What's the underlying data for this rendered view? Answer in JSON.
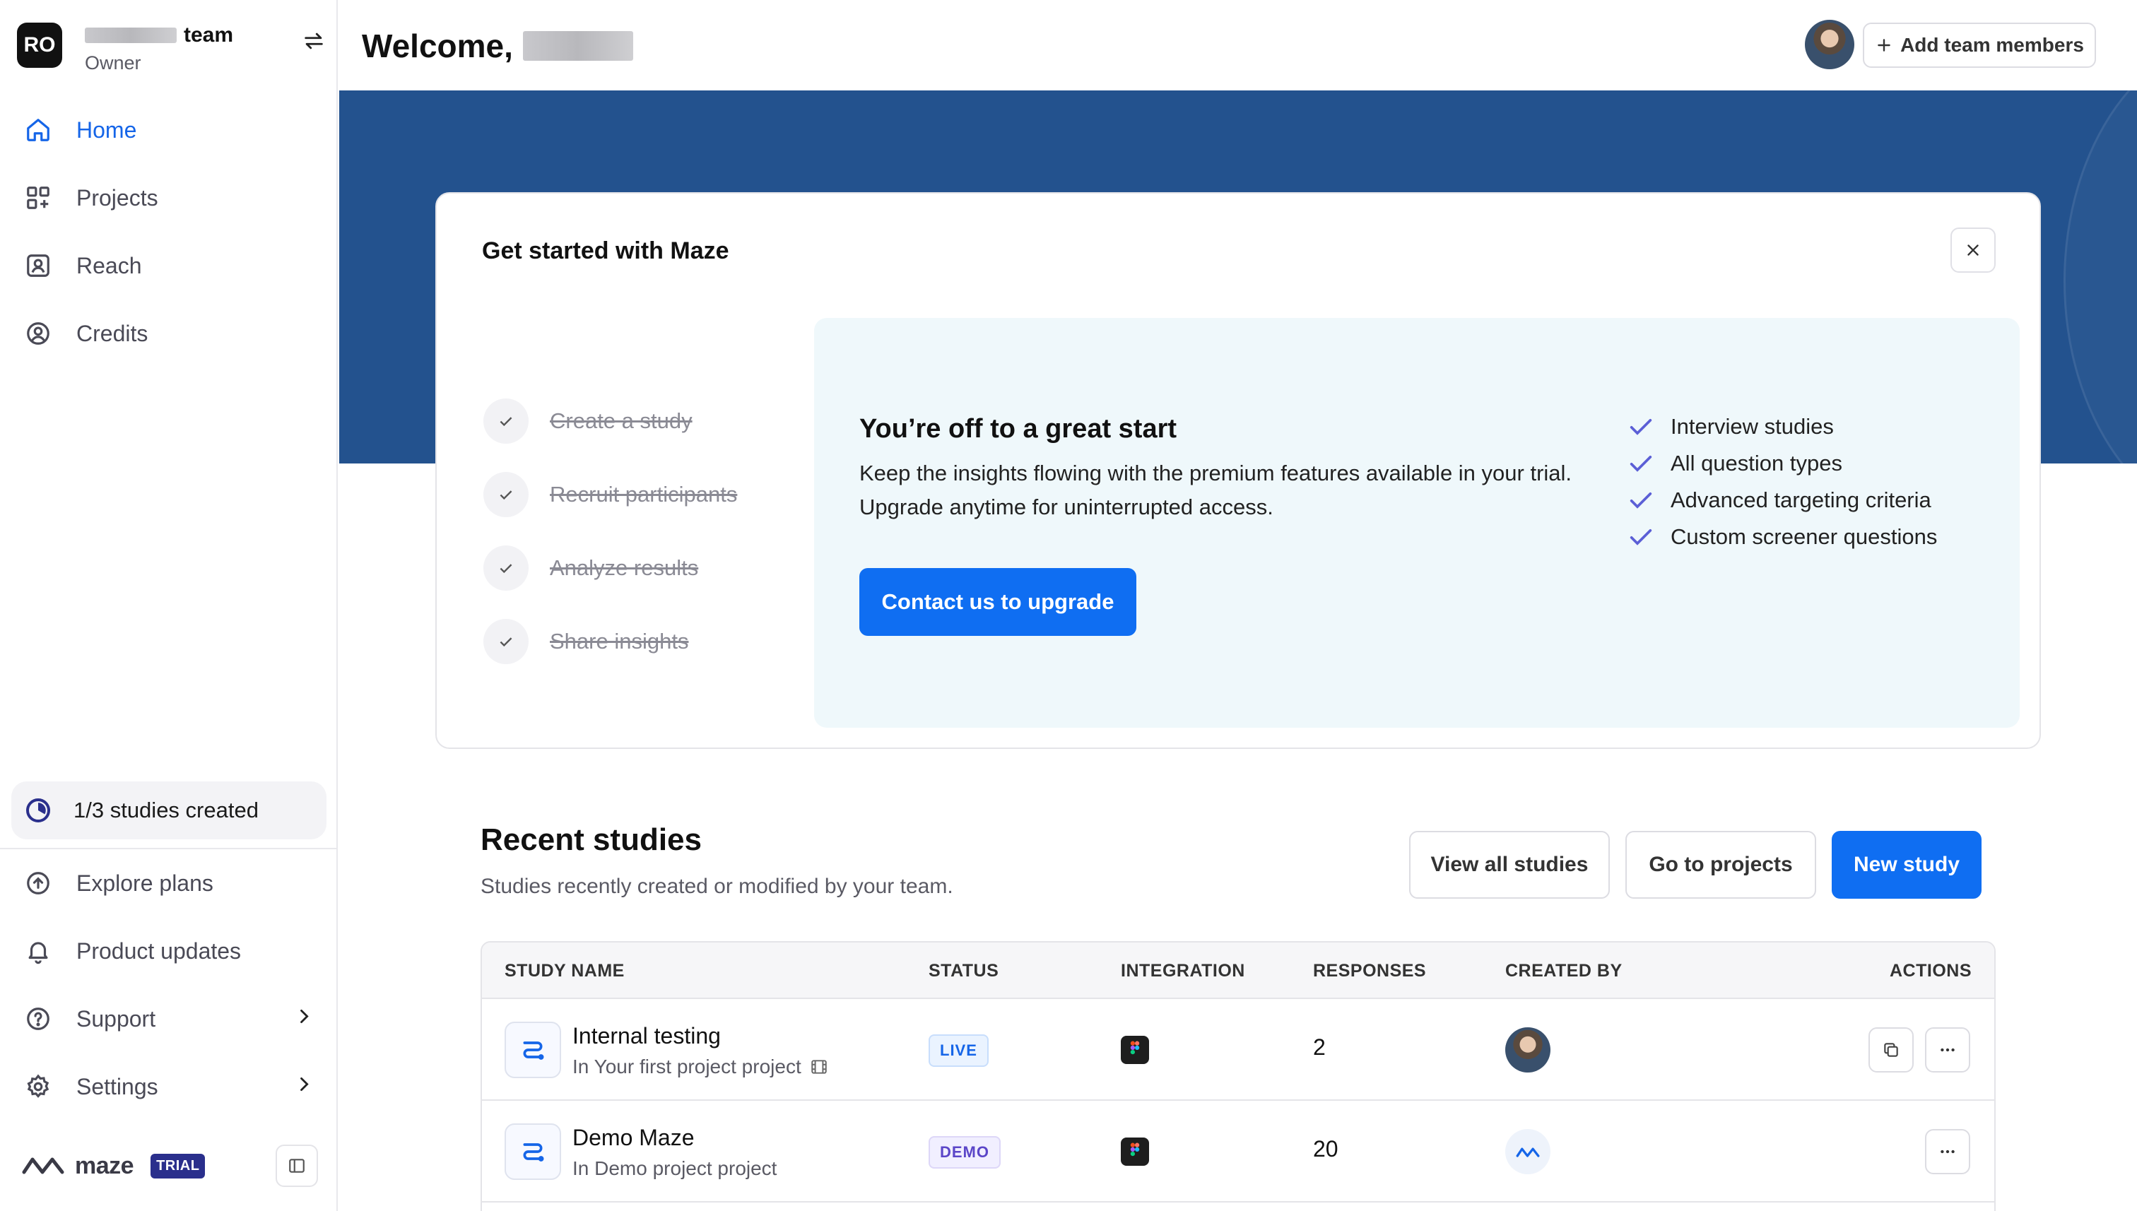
{
  "sidebar": {
    "team": {
      "initials": "RO",
      "name_suffix": "team",
      "role": "Owner"
    },
    "nav": [
      {
        "label": "Home",
        "icon": "home-icon",
        "active": true
      },
      {
        "label": "Projects",
        "icon": "projects-icon"
      },
      {
        "label": "Reach",
        "icon": "reach-icon"
      },
      {
        "label": "Credits",
        "icon": "credits-icon"
      }
    ],
    "studies_progress": "1/3 studies created",
    "bottom_nav": [
      {
        "label": "Explore plans",
        "icon": "arrow-up-circle-icon"
      },
      {
        "label": "Product updates",
        "icon": "bell-icon"
      },
      {
        "label": "Support",
        "icon": "help-icon"
      },
      {
        "label": "Settings",
        "icon": "gear-icon"
      }
    ],
    "brand": "maze",
    "plan_badge": "TRIAL"
  },
  "header": {
    "welcome": "Welcome,",
    "add_members": "Add team members"
  },
  "get_started": {
    "title": "Get started with Maze",
    "steps": [
      "Create a study",
      "Recruit participants",
      "Analyze results",
      "Share insights"
    ],
    "promo_title": "You’re off to a great start",
    "promo_text": "Keep the insights flowing with the premium features available in your trial. Upgrade anytime for uninterrupted access.",
    "promo_button": "Contact us to upgrade",
    "features": [
      "Interview studies",
      "All question types",
      "Advanced targeting criteria",
      "Custom screener questions"
    ]
  },
  "recent": {
    "title": "Recent studies",
    "subtitle": "Studies recently created or modified by your team.",
    "view_all": "View all studies",
    "go_projects": "Go to projects",
    "new_study": "New study",
    "columns": [
      "STUDY NAME",
      "STATUS",
      "INTEGRATION",
      "RESPONSES",
      "CREATED BY",
      "ACTIONS"
    ],
    "rows": [
      {
        "name": "Internal testing",
        "project": "In Your first project project",
        "status": "LIVE",
        "integration": "figma-icon",
        "responses": "2"
      },
      {
        "name": "Demo Maze",
        "project": "In Demo project project",
        "status": "DEMO",
        "integration": "figma-icon",
        "responses": "20"
      }
    ]
  },
  "colors": {
    "accent": "#0f6ef2",
    "banner": "#23528e",
    "promo_bg": "#eff8fb",
    "feature_check": "#5b5fd6"
  }
}
